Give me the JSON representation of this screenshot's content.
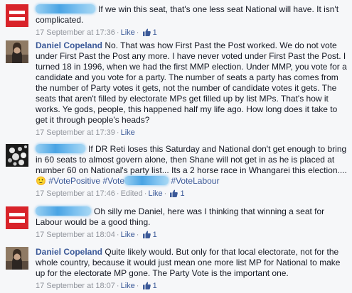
{
  "colors": {
    "link": "#3b5998",
    "meta": "#90949c",
    "labour_red": "#d8232a",
    "redaction": "#4aa4e4"
  },
  "comments": [
    {
      "avatar": "equals-logo-avatar",
      "text": "If we win this seat, that's one less seat National will have. It isn't complicated.",
      "time": "17 September at 17:36",
      "like": "Like",
      "likes": "1"
    },
    {
      "avatar": "photo-avatar",
      "author": "Daniel Copeland",
      "text": "No. That was how First Past the Post worked. We do not vote under First Past the Post any more. I have never voted under First Past the Post. I turned 18 in 1996, when we had the first MMP election. Under MMP, you vote for a candidate and you vote for a party. The number of seats a party has comes from the number of Party votes it gets, not the number of candidate votes it gets. The seats that aren't filled by electorate MPs get filled up by list MPs. That's how it works. Ye gods, people, this happened half my life ago. How long does it take to get it through people's heads?",
      "time": "17 September at 17:39",
      "like": "Like"
    },
    {
      "avatar": "pattern-avatar",
      "text": "If DR Reti loses this Saturday and National don't get enough to bring in 60 seats to almost govern alone, then Shane will not get in as he is placed at number 60 on National's party list... Its a 2 horse race in Whangarei this election....",
      "emoji": "🙂",
      "tag1": "#VotePositive",
      "tag2": "#Vote",
      "tag3": "#VoteLabour",
      "time": "17 September at 17:46",
      "edited": "Edited",
      "like": "Like",
      "likes": "1"
    },
    {
      "avatar": "equals-logo-avatar",
      "text": "Oh silly me Daniel, here was I thinking that winning a seat for Labour would be a good thing.",
      "time": "17 September at 18:04",
      "like": "Like",
      "likes": "1"
    },
    {
      "avatar": "photo-avatar",
      "author": "Daniel Copeland",
      "text": "Quite likely would. But only for that local electorate, not for the whole country, because it would just mean one more list MP for National to make up for the electorate MP gone. The Party Vote is the important one.",
      "time": "17 September at 18:07",
      "like": "Like",
      "likes": "1"
    }
  ]
}
